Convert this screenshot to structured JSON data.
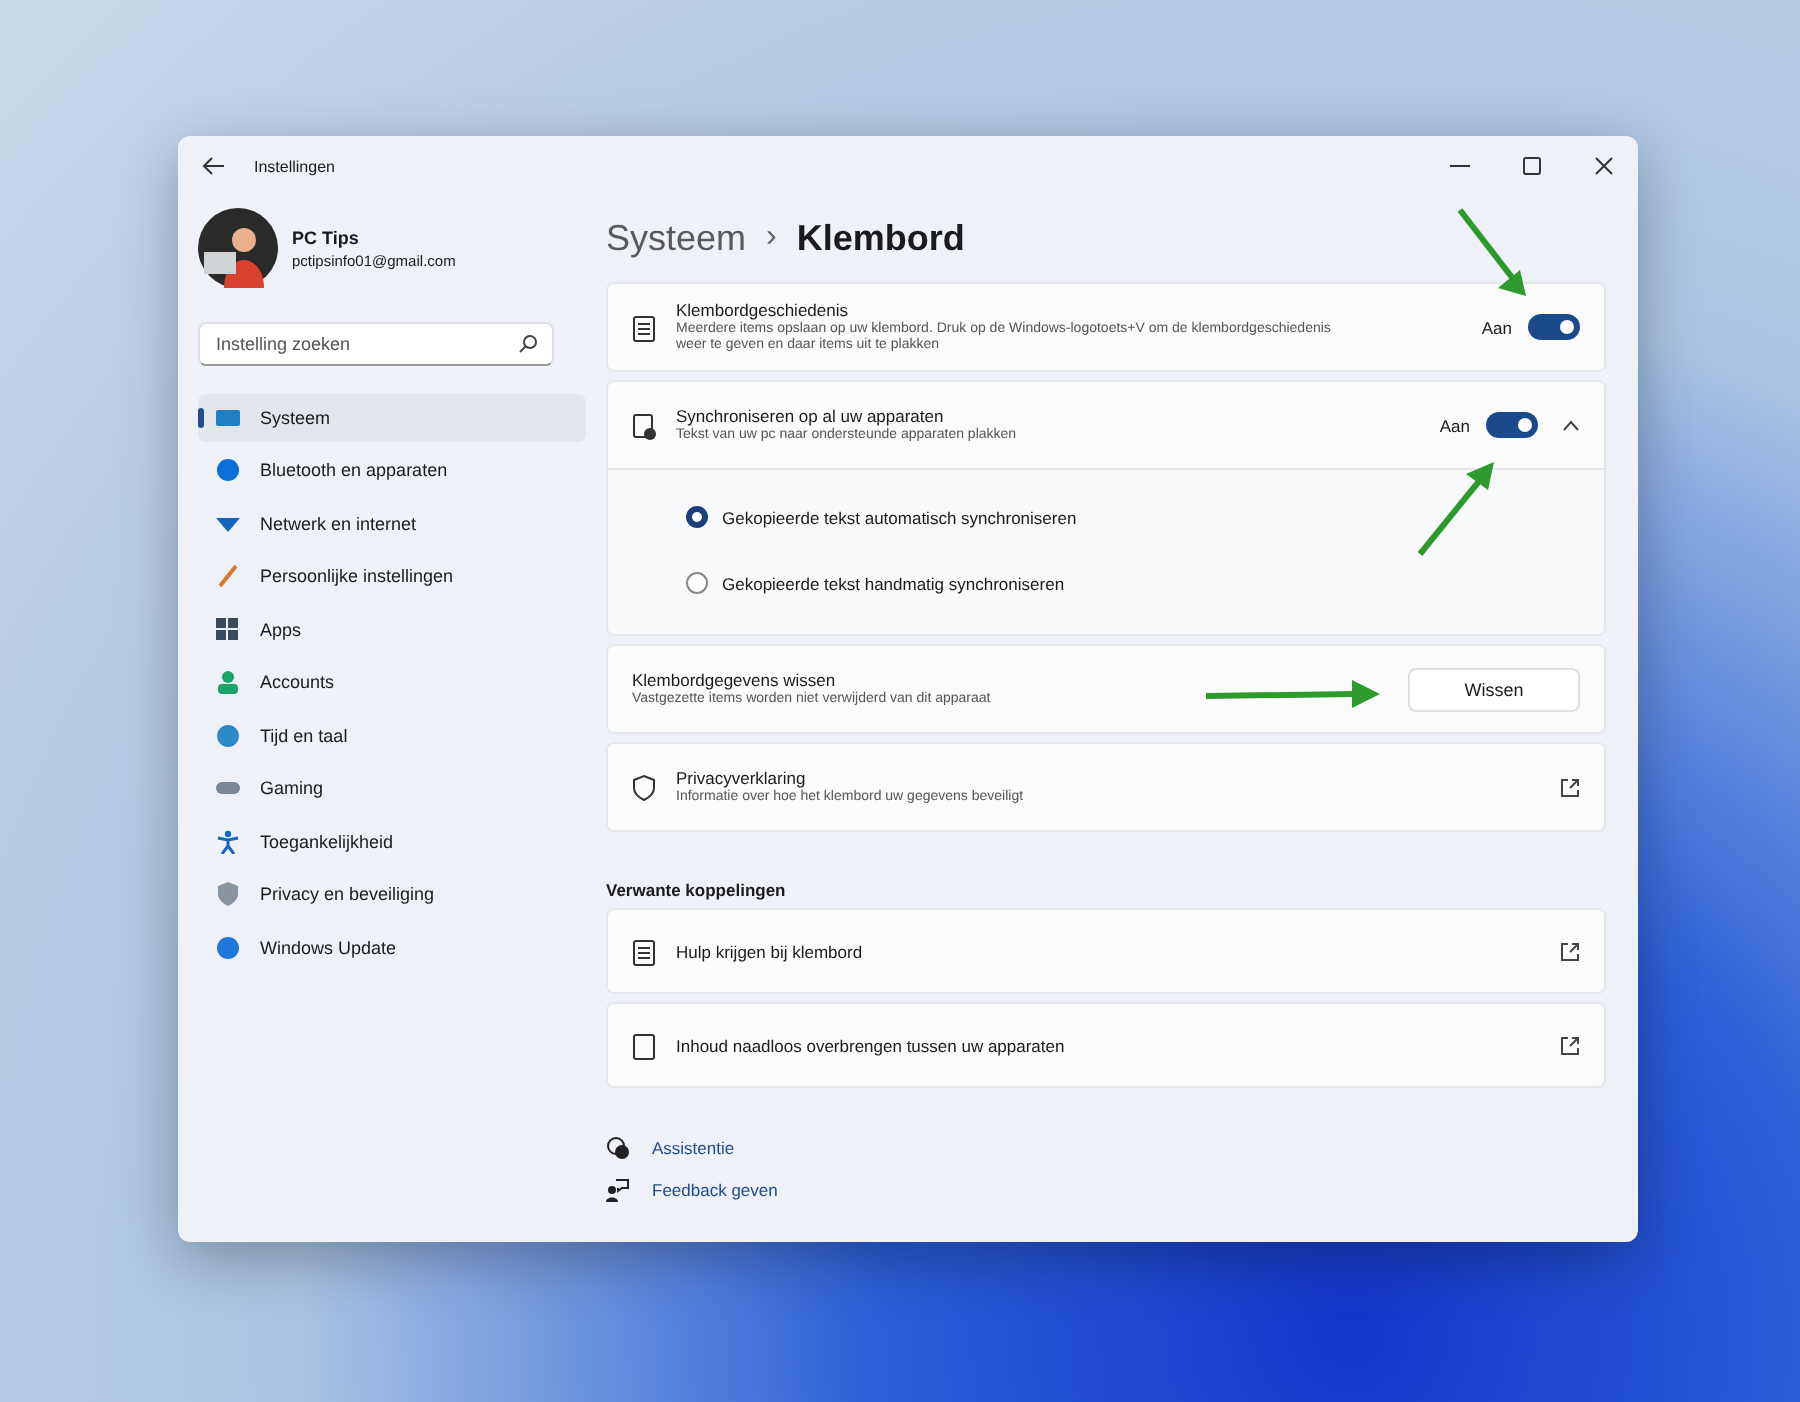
{
  "window": {
    "title": "Instellingen"
  },
  "profile": {
    "name": "PC Tips",
    "email": "pctipsinfo01@gmail.com"
  },
  "search": {
    "placeholder": "Instelling zoeken"
  },
  "sidebar": {
    "items": [
      {
        "label": "Systeem",
        "selected": true
      },
      {
        "label": "Bluetooth en apparaten",
        "selected": false
      },
      {
        "label": "Netwerk en internet",
        "selected": false
      },
      {
        "label": "Persoonlijke instellingen",
        "selected": false
      },
      {
        "label": "Apps",
        "selected": false
      },
      {
        "label": "Accounts",
        "selected": false
      },
      {
        "label": "Tijd en taal",
        "selected": false
      },
      {
        "label": "Gaming",
        "selected": false
      },
      {
        "label": "Toegankelijkheid",
        "selected": false
      },
      {
        "label": "Privacy en beveiliging",
        "selected": false
      },
      {
        "label": "Windows Update",
        "selected": false
      }
    ]
  },
  "breadcrumb": {
    "parent": "Systeem",
    "separator": "›",
    "current": "Klembord"
  },
  "settings": [
    {
      "kind": "toggle",
      "title": "Klembordgeschiedenis",
      "description": "Meerdere items opslaan op uw klembord. Druk op de Windows-logotoets+V om de klembordgeschiedenis weer te geven en daar items uit te plakken",
      "state_label": "Aan",
      "on": true
    },
    {
      "kind": "toggle",
      "title": "Synchroniseren op al uw apparaten",
      "description": "Tekst van uw pc naar ondersteunde apparaten plakken",
      "state_label": "Aan",
      "on": true,
      "expanded": true,
      "options": [
        {
          "label": "Gekopieerde tekst automatisch synchroniseren",
          "selected": true
        },
        {
          "label": "Gekopieerde tekst handmatig synchroniseren",
          "selected": false
        }
      ]
    },
    {
      "kind": "button",
      "title": "Klembordgegevens wissen",
      "description": "Vastgezette items worden niet verwijderd van dit apparaat",
      "button": "Wissen"
    },
    {
      "kind": "link",
      "title": "Privacyverklaring",
      "description": "Informatie over hoe het klembord uw gegevens beveiligt"
    }
  ],
  "related": {
    "heading": "Verwante koppelingen",
    "items": [
      "Hulp krijgen bij klembord",
      "Inhoud naadloos overbrengen tussen uw apparaten"
    ]
  },
  "footer_links": [
    "Assistentie",
    "Feedback geven"
  ]
}
